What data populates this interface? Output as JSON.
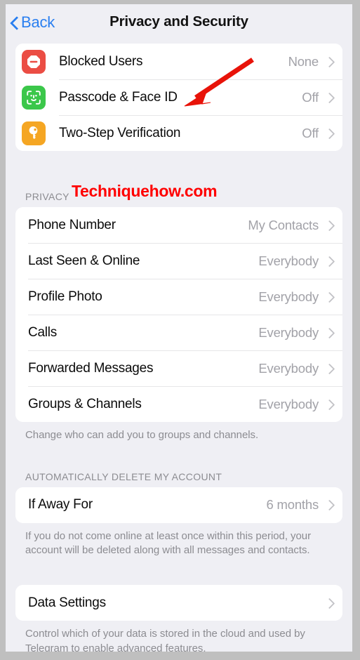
{
  "navbar": {
    "back_label": "Back",
    "back_icon": "chevron-left-icon",
    "title": "Privacy and Security"
  },
  "security_section": {
    "rows": [
      {
        "label": "Blocked Users",
        "value": "None",
        "icon": "block-circle-icon",
        "icon_color": "#eb4d44"
      },
      {
        "label": "Passcode & Face ID",
        "value": "Off",
        "icon": "face-id-icon",
        "icon_color": "#3bc74a"
      },
      {
        "label": "Two-Step Verification",
        "value": "Off",
        "icon": "key-icon",
        "icon_color": "#f5a623"
      }
    ]
  },
  "watermark": {
    "text": "Techniquehow.com",
    "color": "#ff0000"
  },
  "privacy_section": {
    "header": "PRIVACY",
    "rows": [
      {
        "label": "Phone Number",
        "value": "My Contacts"
      },
      {
        "label": "Last Seen & Online",
        "value": "Everybody"
      },
      {
        "label": "Profile Photo",
        "value": "Everybody"
      },
      {
        "label": "Calls",
        "value": "Everybody"
      },
      {
        "label": "Forwarded Messages",
        "value": "Everybody"
      },
      {
        "label": "Groups & Channels",
        "value": "Everybody"
      }
    ],
    "footer": "Change who can add you to groups and channels."
  },
  "auto_delete_section": {
    "header": "AUTOMATICALLY DELETE MY ACCOUNT",
    "rows": [
      {
        "label": "If Away For",
        "value": "6 months"
      }
    ],
    "footer": "If you do not come online at least once within this period, your account will be deleted along with all messages and contacts."
  },
  "data_settings_section": {
    "rows": [
      {
        "label": "Data Settings",
        "value": ""
      }
    ],
    "footer": "Control which of your data is stored in the cloud and used by Telegram to enable advanced features."
  },
  "annotation": {
    "arrow_color": "#e81309",
    "arrow_name": "red-annotation-arrow",
    "points_at": "Passcode & Face ID"
  }
}
